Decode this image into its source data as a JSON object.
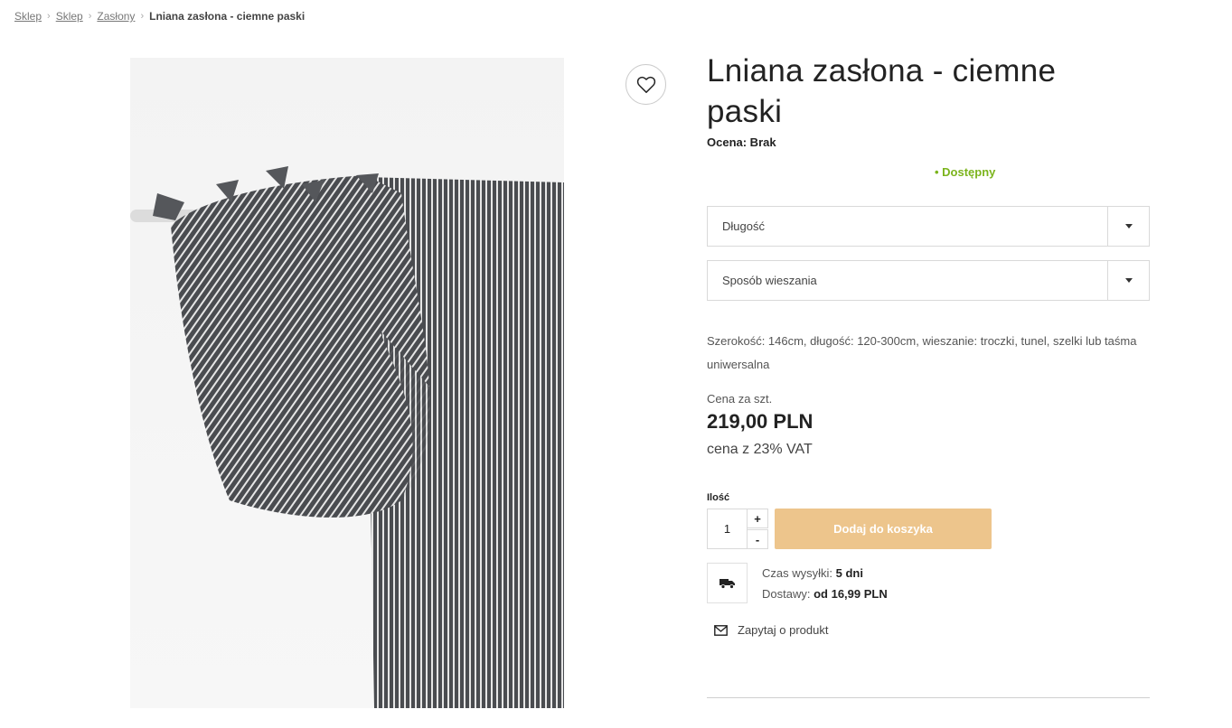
{
  "breadcrumb": {
    "items": [
      "Sklep",
      "Sklep",
      "Zasłony"
    ],
    "current": "Lniana zasłona - ciemne paski"
  },
  "product": {
    "title": "Lniana zasłona - ciemne paski",
    "rating": "Ocena: Brak",
    "availability": "• Dostępny",
    "availability_color": "#7bb41c",
    "options": {
      "length_placeholder": "Długość",
      "hanging_placeholder": "Sposób wieszania"
    },
    "description": "Szerokość: 146cm, długość: 120-300cm, wieszanie: troczki, tunel, szelki lub taśma uniwersalna",
    "price_label": "Cena za szt.",
    "price": "219,00 PLN",
    "vat_note": "cena z 23% VAT",
    "quantity_label": "Ilość",
    "quantity": "1",
    "qty_plus": "+",
    "qty_minus": "-",
    "add_to_cart": "Dodaj do koszyka",
    "add_to_cart_color": "#edc58c",
    "shipping": {
      "time_label": "Czas wysyłki:",
      "time_value": "5 dni",
      "cost_label": "Dostawy:",
      "cost_value": "od 16,99 PLN"
    },
    "ask": "Zapytaj o produkt"
  },
  "icons": {
    "wishlist": "heart-icon",
    "truck": "truck-icon",
    "mail": "mail-icon",
    "dropdown": "caret-down-icon"
  }
}
